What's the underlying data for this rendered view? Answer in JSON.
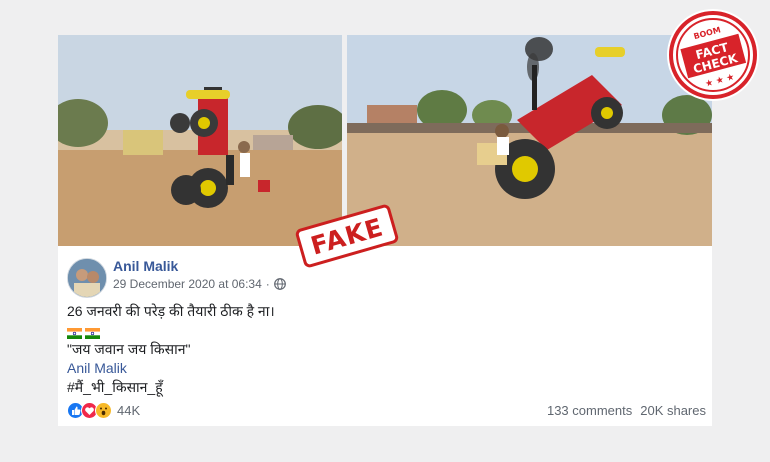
{
  "photos": [
    {
      "name": "left-photo",
      "description": "stunt tractor rearing up on its back wheels"
    },
    {
      "name": "right-photo",
      "description": "red tractor doing a wheelie in a dirt field"
    }
  ],
  "stamp": {
    "label": "FAKE"
  },
  "badge": {
    "top": "BOOM",
    "line1": "FACT",
    "line2": "CHECK",
    "stars": "★ ★ ★"
  },
  "post": {
    "author": "Anil Malik",
    "date": "29 December 2020 at 06:34",
    "separator": "·",
    "text_line1": "26 जनवरी की परेड़ की तैयारी ठीक है ना।",
    "quote": "\"जय जवान जय किसान\"",
    "mention": "Anil Malik",
    "hashtag": "#मैं_भी_किसान_हूँ",
    "reaction_count": "44K",
    "comments": "133 comments",
    "shares": "20K shares"
  },
  "colors": {
    "link": "#385898",
    "stamp_red": "#cc1f1f",
    "like_blue": "#1877f2",
    "love_red": "#f0284a",
    "wow_yellow": "#f7b928"
  }
}
